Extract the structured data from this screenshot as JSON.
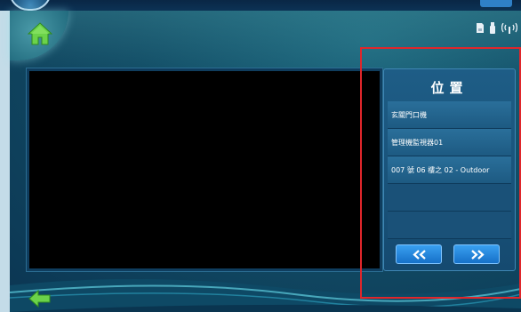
{
  "header": {
    "home_icon": "home-icon",
    "status_icons": [
      "sd-card-icon",
      "usb-icon",
      "wireless-signal-icon"
    ]
  },
  "location_panel": {
    "title": "位置",
    "items": [
      "玄關門口機",
      "管理機監視器01",
      "007 號 06 樓之 02 - Outdoor",
      "",
      ""
    ],
    "prev_label": "<<",
    "next_label": ">>"
  },
  "footer": {
    "back_icon": "back-arrow-icon"
  },
  "colors": {
    "accent": "#2f80c7",
    "selection_outline": "#e0262b",
    "home_green": "#6bd34a"
  }
}
